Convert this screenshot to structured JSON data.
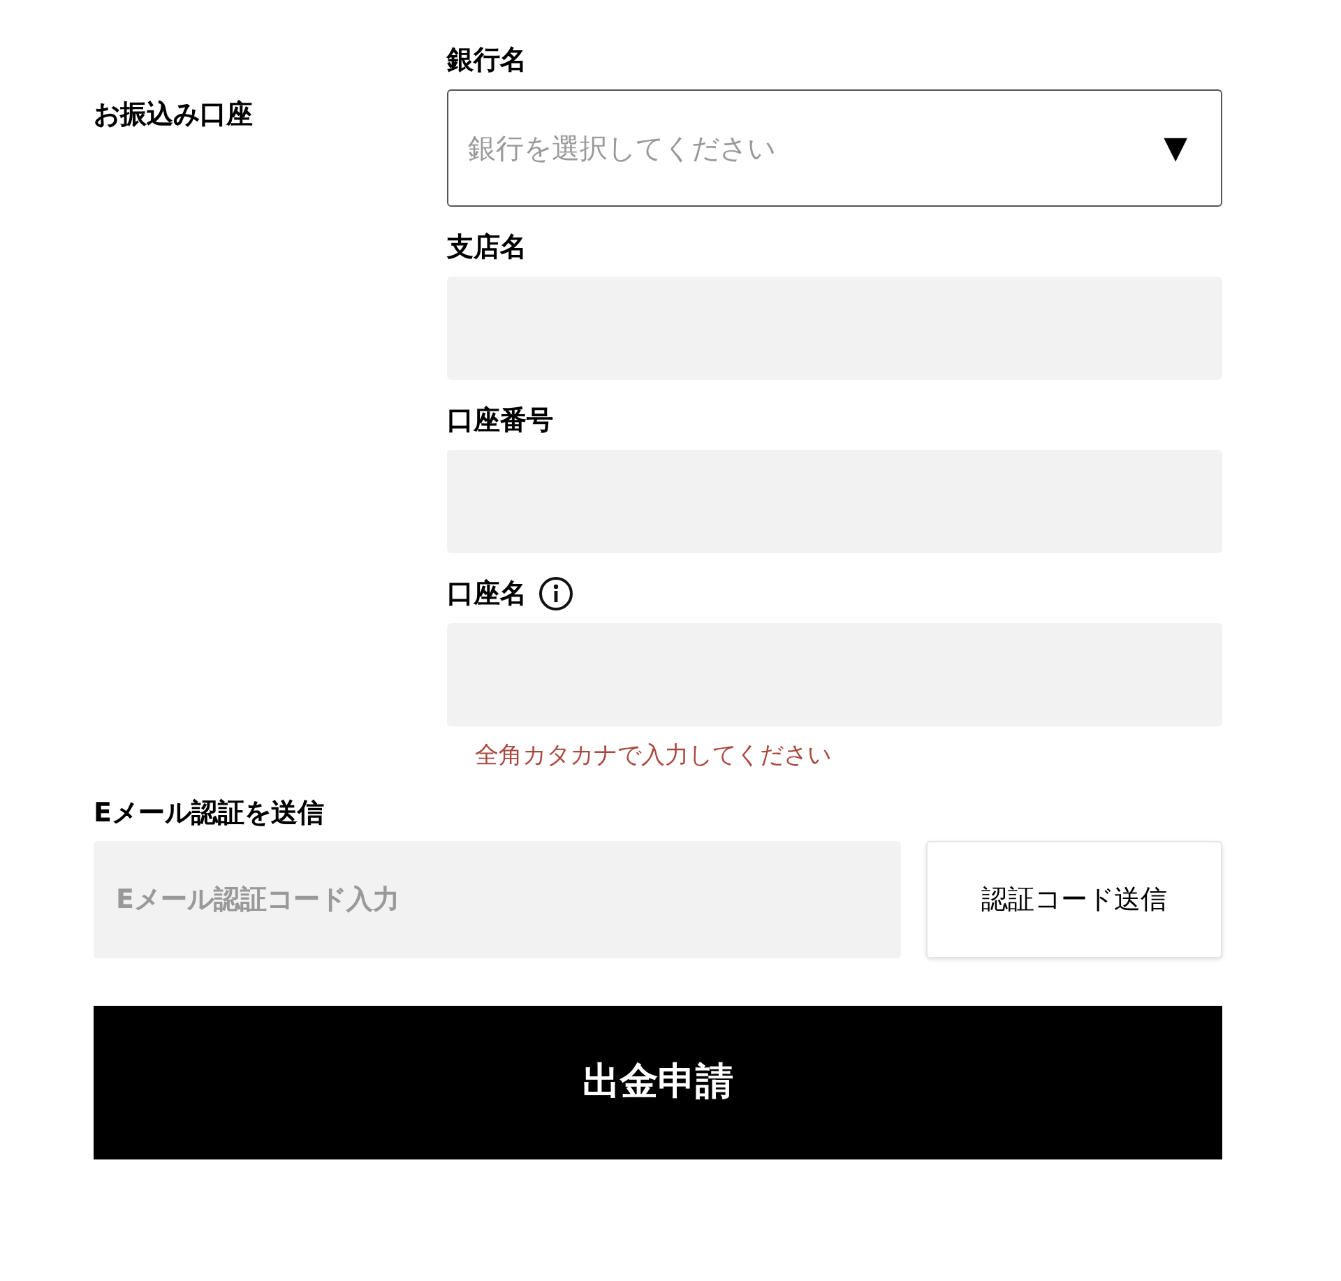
{
  "account_section": {
    "label": "お振込み口座"
  },
  "fields": [
    {
      "kind": "select",
      "label": "銀行名",
      "placeholder": "銀行を選択してください",
      "caret": "▼"
    },
    {
      "kind": "input",
      "label": "支店名"
    },
    {
      "kind": "input",
      "label": "口座番号"
    },
    {
      "kind": "input",
      "label": "口座名",
      "info": true,
      "hint": "全角カタカナで入力してください"
    }
  ],
  "email": {
    "label": "Eメール認証を送信",
    "placeholder": "Eメール認証コード入力",
    "send_button": "認証コード送信"
  },
  "submit_button": "出金申請"
}
